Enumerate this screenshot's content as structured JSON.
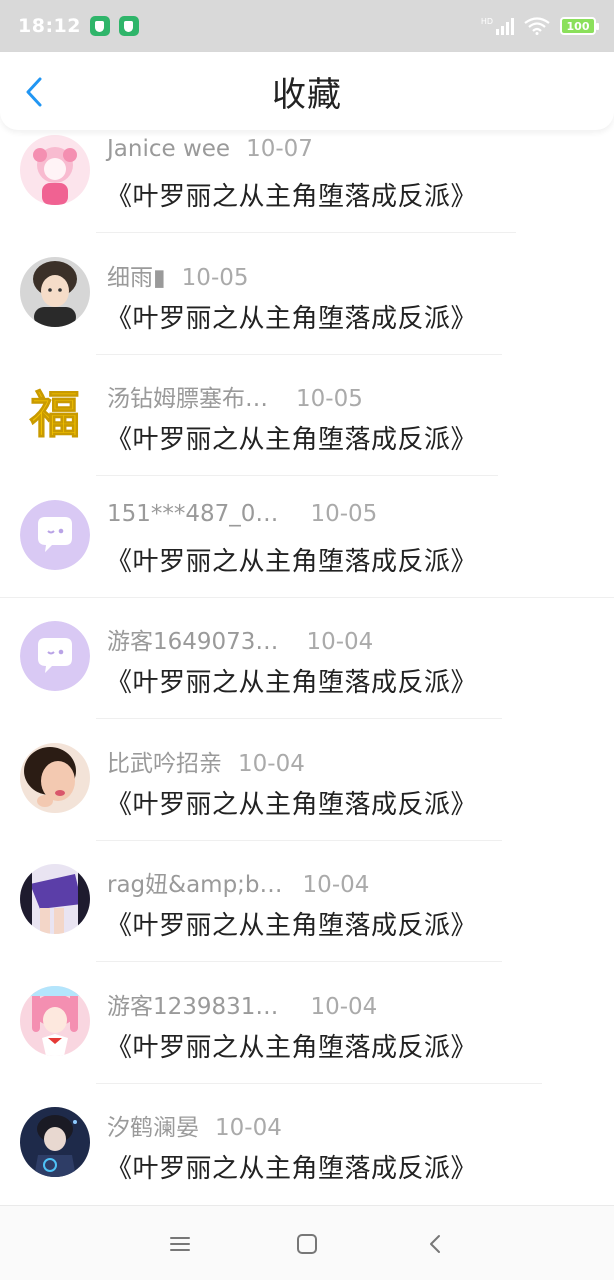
{
  "status_bar": {
    "time": "18:12",
    "hd_label": "HD",
    "battery_level": "100"
  },
  "header": {
    "back_icon": "chevron-left-icon",
    "title": "收藏",
    "accent_color": "#2196f3"
  },
  "items": [
    {
      "user": "Janice wee",
      "date": "10-07",
      "title": "《叶罗丽之从主角堕落成反派》",
      "avatar": "pink-girl-avatar"
    },
    {
      "user": "细雨▮",
      "date": "10-05",
      "title": "《叶罗丽之从主角堕落成反派》",
      "avatar": "boy-avatar"
    },
    {
      "user": "汤钻姆膘塞布…",
      "date": "10-05",
      "title": "《叶罗丽之从主角堕落成反派》",
      "avatar": "fu-character-avatar"
    },
    {
      "user": "151***487_0…",
      "date": "10-05",
      "title": "《叶罗丽之从主角堕落成反派》",
      "avatar": "default-chat-avatar"
    },
    {
      "user": "游客1649073…",
      "date": "10-04",
      "title": "《叶罗丽之从主角堕落成反派》",
      "avatar": "default-chat-avatar"
    },
    {
      "user": "比武吟招亲",
      "date": "10-04",
      "title": "《叶罗丽之从主角堕落成反派》",
      "avatar": "woman-photo-avatar"
    },
    {
      "user": "rag妞&amp;b…",
      "date": "10-04",
      "title": "《叶罗丽之从主角堕落成反派》",
      "avatar": "purple-skirt-avatar"
    },
    {
      "user": "游客1239831…",
      "date": "10-04",
      "title": "《叶罗丽之从主角堕落成反派》",
      "avatar": "sailor-girl-avatar"
    },
    {
      "user": "汐鹤澜晏",
      "date": "10-04",
      "title": "《叶罗丽之从主角堕落成反派》",
      "avatar": "blue-boy-avatar"
    }
  ],
  "nav_bar": {
    "menu_icon": "menu-icon",
    "home_icon": "home-square-icon",
    "back_icon": "back-triangle-icon"
  }
}
